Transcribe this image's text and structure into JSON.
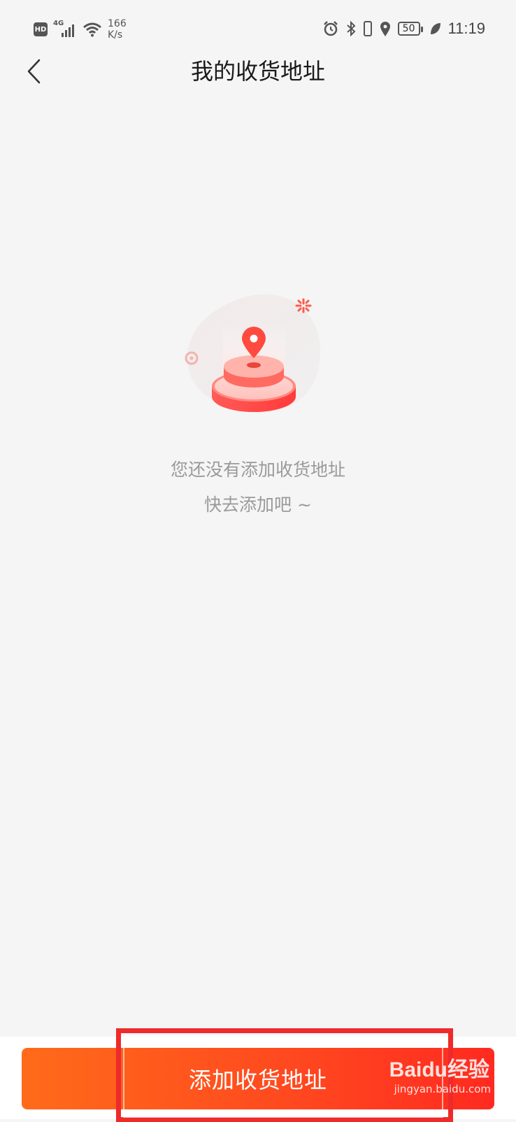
{
  "status_bar": {
    "hd": "HD",
    "network_type": "4G",
    "speed_value": "166",
    "speed_unit": "K/s",
    "battery": "50",
    "time": "11:19"
  },
  "header": {
    "title": "我的收货地址"
  },
  "empty_state": {
    "line1": "您还没有添加收货地址",
    "line2": "快去添加吧 ~"
  },
  "bottom": {
    "add_button_label": "添加收货地址"
  },
  "watermark": {
    "brand": "Baidu经验",
    "url": "jingyan.baidu.com"
  },
  "colors": {
    "accent_start": "#ff6b1a",
    "accent_end": "#ff2a20",
    "highlight": "#ee2a2a"
  }
}
